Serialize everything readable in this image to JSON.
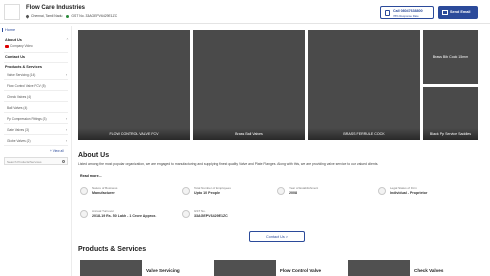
{
  "header": {
    "company_name": "Flow Care Industries",
    "location": "Chennai, Tamil Nadu",
    "gst": "GST No. 33AGEPV6429E1ZC",
    "call_label": "Call 08047638800",
    "call_rate": "78% Response Rate",
    "email_label": "Send Email"
  },
  "sidebar": {
    "home": "Home",
    "about": "About Us",
    "company_video": "Company Video",
    "contact": "Contact Us",
    "products_services": "Products & Services",
    "items": [
      "Valve Servicing (14)",
      "Flow Control Valve FCV (5)",
      "Check Valves (4)",
      "Ball Valves (4)",
      "Pp Compression Fittings (3)",
      "Gate Valves (3)",
      "Globe Valves (2)"
    ],
    "view_all": "+ View all",
    "search_placeholder": "Search Products/Services"
  },
  "tiles": {
    "t1": "FLOW CONTROL VALVE  FCV",
    "t2": "Brass Ball Valves",
    "t3": "BRASS FERRULE COCK",
    "t4": "Brass Bib Cock 15mm",
    "t5": "Black Pp Service Saddles"
  },
  "about": {
    "title": "About Us",
    "text": "Listed among the most popular organization, we are engaged to manufacturing and supplying finest quality Valve and Plate Flanges. Along with this, we are providing valve service to our valued clients.",
    "read_more": "Read more...",
    "facts": {
      "business": {
        "label": "Nature of Business",
        "value": "Manufacturer"
      },
      "employees": {
        "label": "Total Number of Employees",
        "value": "Upto 10 People"
      },
      "established": {
        "label": "Year of Establishment",
        "value": "2008"
      },
      "legal": {
        "label": "Legal Status of Firm",
        "value": "Individual - Proprietor"
      },
      "turnover": {
        "label": "Annual Turnover",
        "value": "2018-19 Rs. 50 Lakh - 1 Crore Approx."
      },
      "gst": {
        "label": "GST No.",
        "value": "33AGEPV6429E1ZC"
      }
    },
    "contact_btn": "Contact Us >"
  },
  "products": {
    "title": "Products & Services",
    "cards": [
      "Valve Servicing",
      "Flow Control Valve",
      "Check Valves"
    ]
  },
  "colors": {
    "brand_blue": "#2b4a9a",
    "tile_gray": "#4a4a4a",
    "video_red": "#dd0000"
  }
}
